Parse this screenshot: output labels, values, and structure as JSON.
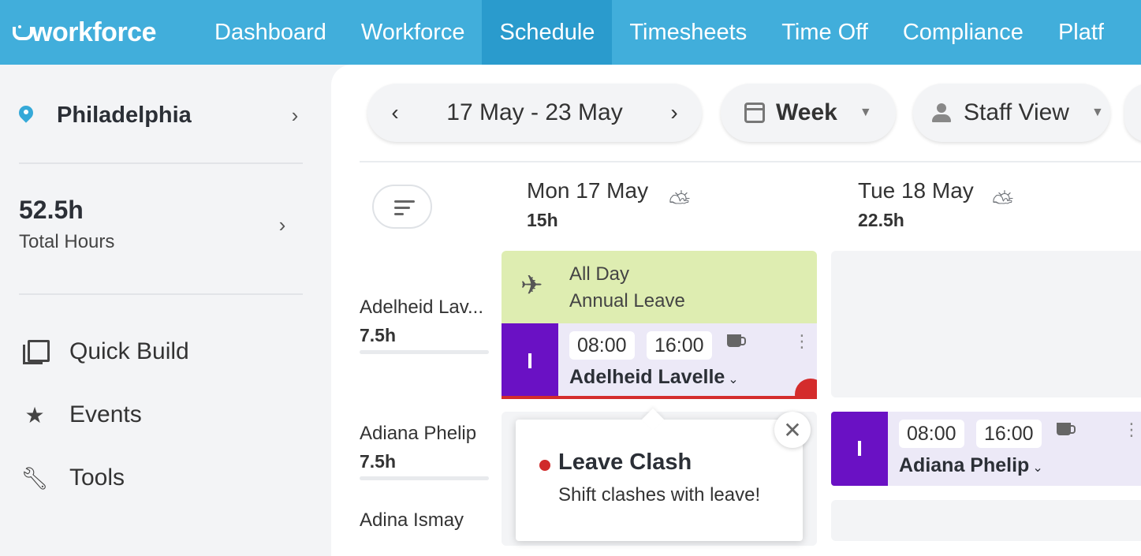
{
  "nav": {
    "logo": "workforce",
    "items": [
      {
        "label": "Dashboard"
      },
      {
        "label": "Workforce"
      },
      {
        "label": "Schedule",
        "active": true
      },
      {
        "label": "Timesheets"
      },
      {
        "label": "Time Off"
      },
      {
        "label": "Compliance"
      },
      {
        "label": "Platf"
      }
    ],
    "accent_color": "#41aedb"
  },
  "sidebar": {
    "location": "Philadelphia",
    "total_hours_value": "52.5h",
    "total_hours_label": "Total Hours",
    "menu": [
      {
        "label": "Quick Build",
        "icon": "quick-build-icon"
      },
      {
        "label": "Events",
        "icon": "star-icon"
      },
      {
        "label": "Tools",
        "icon": "wrench-icon"
      }
    ]
  },
  "toolbar": {
    "date_range": "17 May - 23 May",
    "view_period": "Week",
    "view_mode": "Staff View"
  },
  "days": [
    {
      "title": "Mon 17 May",
      "hours": "15h",
      "weather_icon": "partly-cloudy-icon"
    },
    {
      "title": "Tue 18 May",
      "hours": "22.5h",
      "weather_icon": "partly-cloudy-icon"
    }
  ],
  "staff": [
    {
      "name": "Adelheid Lav...",
      "hours": "7.5h"
    },
    {
      "name": "Adiana Phelip",
      "hours": "7.5h"
    },
    {
      "name": "Adina Ismay"
    }
  ],
  "leave": {
    "line1": "All Day",
    "line2": "Annual Leave",
    "color": "#deedb1"
  },
  "shifts": [
    {
      "badge": "I",
      "start": "08:00",
      "end": "16:00",
      "name": "Adelheid Lavelle",
      "clash": true,
      "color": "#6a11c4"
    },
    {
      "badge": "I",
      "start": "08:00",
      "end": "16:00",
      "name": "Adiana Phelip",
      "clash": false,
      "color": "#6a11c4"
    }
  ],
  "popover": {
    "title": "Leave Clash",
    "body": "Shift clashes with leave!",
    "close": "✕",
    "status_color": "#d02a2a"
  }
}
